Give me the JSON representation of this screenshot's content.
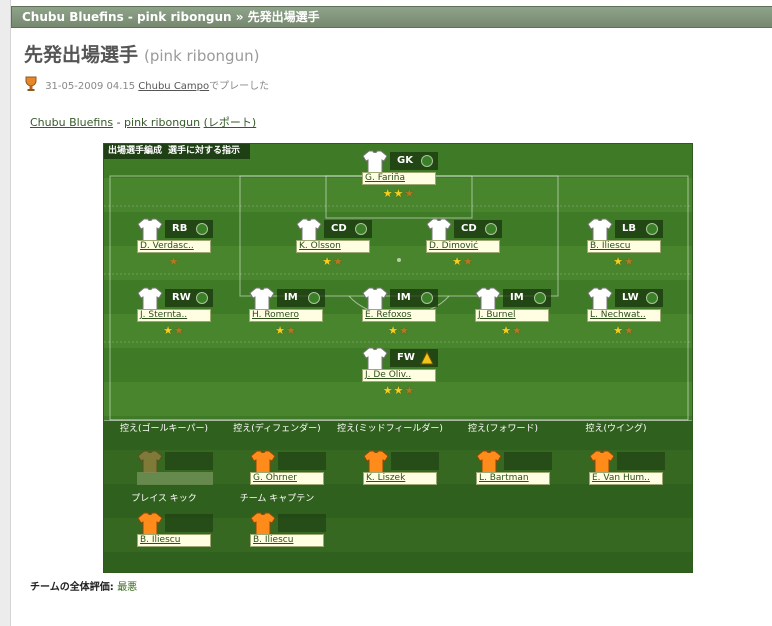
{
  "header": {
    "title": "Chubu Bluefins - pink ribongun » 先発出場選手"
  },
  "page": {
    "title": "先発出場選手",
    "subtitle": "(pink ribongun)",
    "date": "31-05-2009 04.15",
    "venue": "Chubu Campo",
    "played_suffix": "でプレーした"
  },
  "links": {
    "team": "Chubu Bluefins",
    "sep": "-",
    "opponent": "pink ribongun",
    "report": "(レポート)"
  },
  "pitch": {
    "tab_formation": "出場選手編成",
    "tab_instructions": "選手に対する指示"
  },
  "players": {
    "gk": {
      "pos": "GK",
      "name": "G. Fariña",
      "stars": "★★",
      "half": "★"
    },
    "rb": {
      "pos": "RB",
      "name": "D. Verdasc..",
      "stars": "",
      "half": "★"
    },
    "cd1": {
      "pos": "CD",
      "name": "K. Olsson",
      "stars": "★",
      "half": "★"
    },
    "cd2": {
      "pos": "CD",
      "name": "D. Dimović",
      "stars": "★",
      "half": "★"
    },
    "lb": {
      "pos": "LB",
      "name": "B. Iliescu",
      "stars": "★",
      "half": "★"
    },
    "rw": {
      "pos": "RW",
      "name": "J. Sternta..",
      "stars": "★",
      "half": "★"
    },
    "im1": {
      "pos": "IM",
      "name": "H. Romero",
      "stars": "★",
      "half": "★"
    },
    "im2": {
      "pos": "IM",
      "name": "E. Refoxos",
      "stars": "★",
      "half": "★"
    },
    "im3": {
      "pos": "IM",
      "name": "J. Burnel",
      "stars": "★",
      "half": "★"
    },
    "lw": {
      "pos": "LW",
      "name": "L. Nechwat..",
      "stars": "★",
      "half": "★"
    },
    "fw": {
      "pos": "FW",
      "name": "J. De Oliv..",
      "stars": "★★",
      "half": "★"
    }
  },
  "subs": {
    "gk": {
      "label": "控え(ゴールキーパー)",
      "name": ""
    },
    "def": {
      "label": "控え(ディフェンダー)",
      "name": "G. Ohrner"
    },
    "mid": {
      "label": "控え(ミッドフィールダー)",
      "name": "K. Liszek"
    },
    "fwd": {
      "label": "控え(フォワード)",
      "name": "L. Bartman"
    },
    "wing": {
      "label": "控え(ウイング)",
      "name": "E. Van Hum.."
    },
    "setpiece": {
      "label": "プレイス キック",
      "name": "B. Iliescu"
    },
    "captain": {
      "label": "チーム キャプテン",
      "name": "B. Iliescu"
    }
  },
  "rating": {
    "label": "チームの全体評価:",
    "value": "最悪"
  },
  "colors": {
    "header": "#7e9277",
    "pitch": "#3f7a26",
    "sub_shirt": "#ff8c1a",
    "player_shirt": "#ffffff"
  }
}
